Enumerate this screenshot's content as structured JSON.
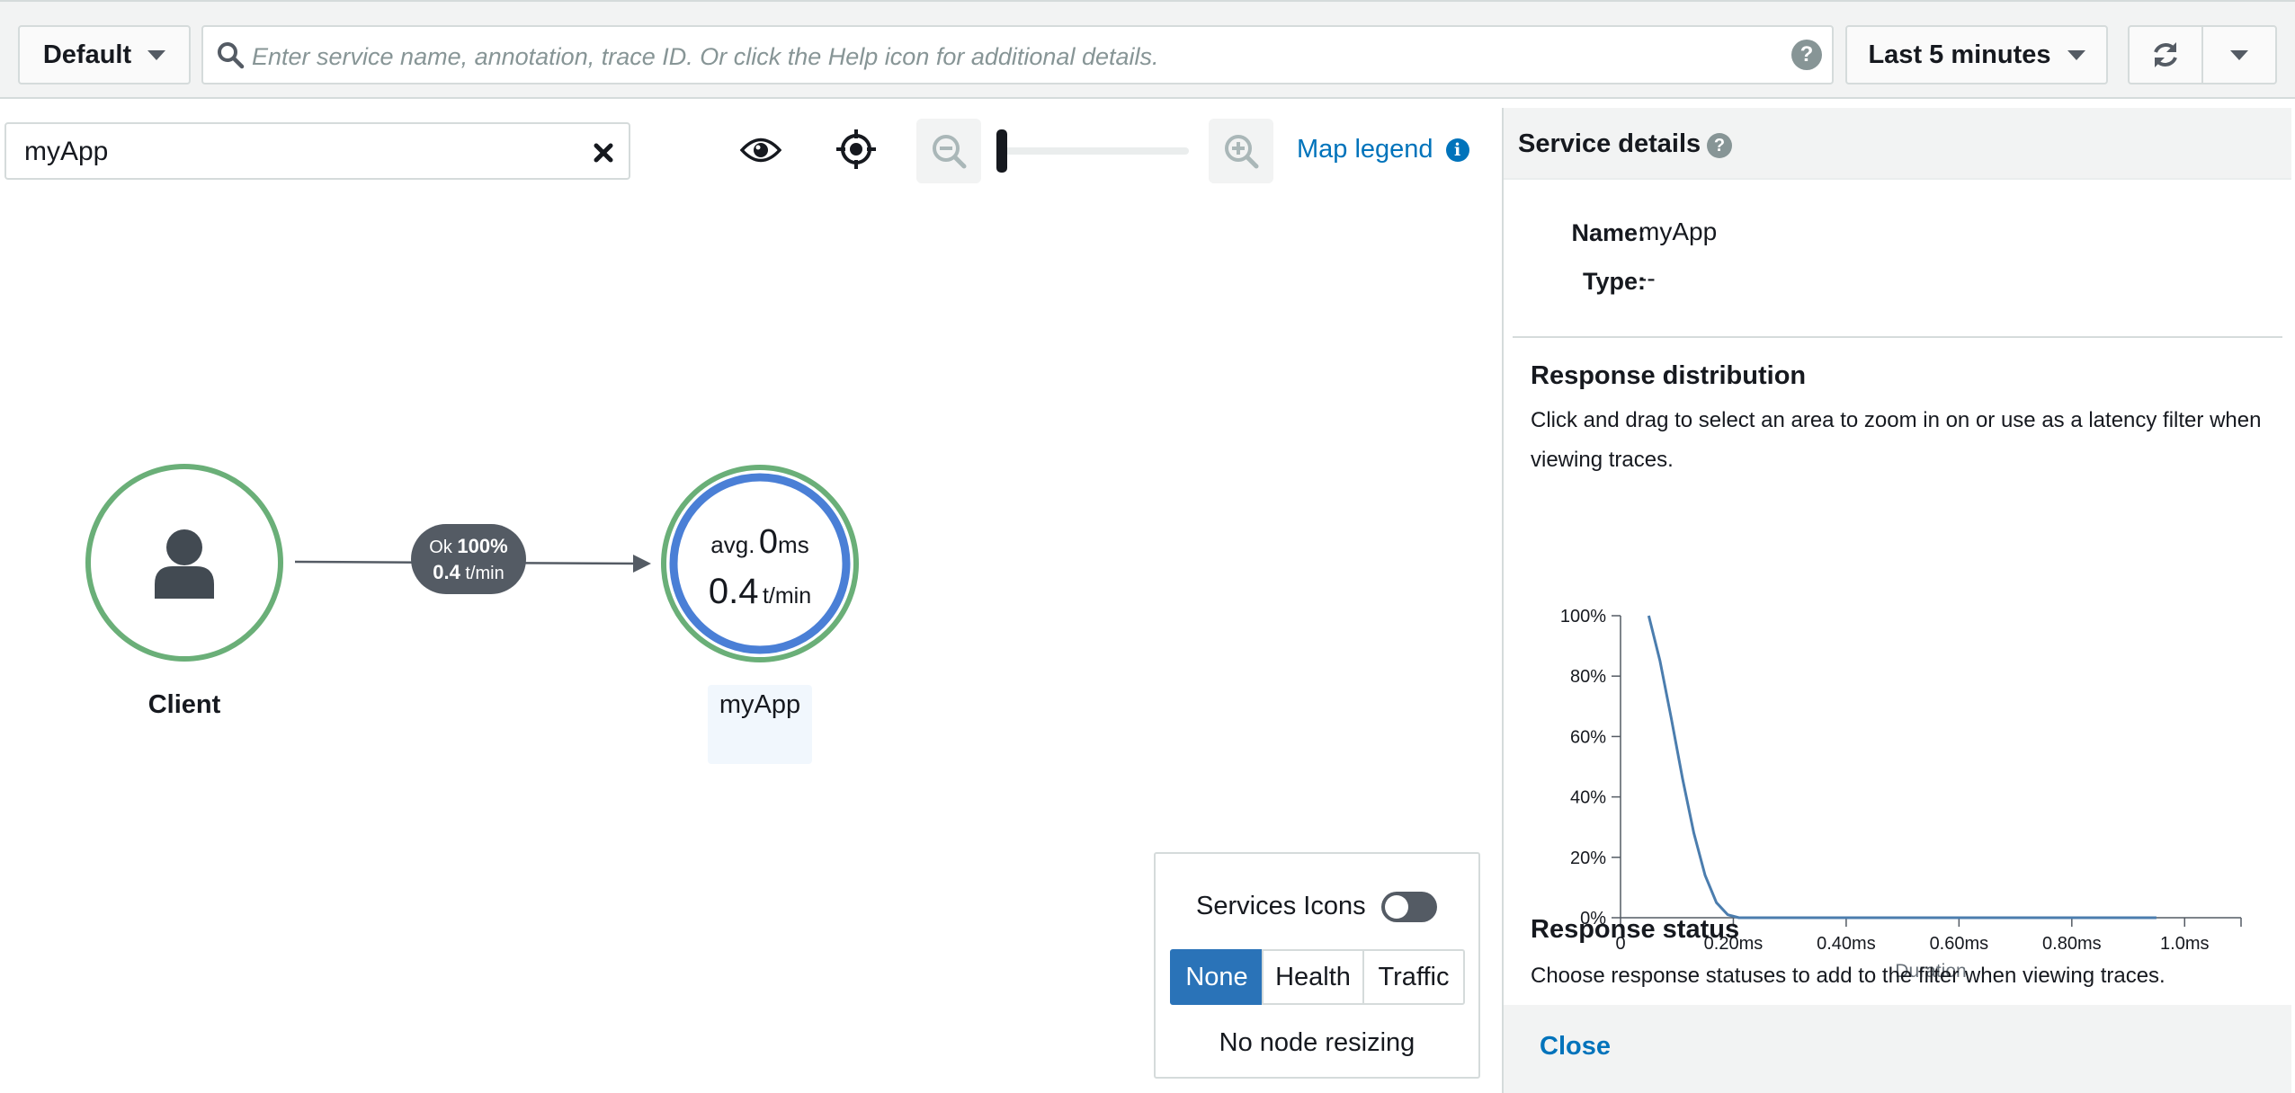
{
  "toolbar": {
    "group_label": "Default",
    "search_placeholder": "Enter service name, annotation, trace ID. Or click the Help icon for additional details.",
    "help_glyph": "?",
    "time_range_label": "Last 5 minutes"
  },
  "filter": {
    "value": "myApp"
  },
  "map_tools": {
    "map_legend_label": "Map legend",
    "info_glyph": "i",
    "zoom_level": 0
  },
  "map": {
    "client": {
      "label": "Client"
    },
    "edge": {
      "status": "Ok",
      "percent": "100%",
      "rate": "0.4",
      "rate_unit": "t/min"
    },
    "service": {
      "label": "myApp",
      "avg_prefix": "avg.",
      "avg_value": "0",
      "avg_unit": "ms",
      "rate": "0.4",
      "rate_unit": "t/min"
    }
  },
  "legend_panel": {
    "services_icons_label": "Services Icons",
    "services_icons_enabled": false,
    "segments": [
      "None",
      "Health",
      "Traffic"
    ],
    "selected_segment": "None",
    "resizing_text": "No node resizing"
  },
  "details": {
    "title": "Service details",
    "help_glyph": "?",
    "name_label": "Name:",
    "name_value": "myApp",
    "type_label": "Type:",
    "type_value": "--",
    "distribution_title": "Response distribution",
    "distribution_desc": "Click and drag to select an area to zoom in on or use as a latency filter when viewing traces.",
    "status_title": "Response status",
    "status_desc": "Choose response statuses to add to the filter when viewing traces.",
    "close_label": "Close"
  },
  "colors": {
    "ok_green": "#6aaf78",
    "service_blue": "#4a7fd6",
    "link_blue": "#0073bb",
    "selected_blue": "#2a73b8",
    "line_blue": "#4b7dae"
  },
  "chart_data": {
    "type": "line",
    "title": "",
    "xlabel": "Duration",
    "ylabel": "",
    "xlim": [
      0,
      1.1
    ],
    "ylim": [
      0,
      100
    ],
    "x_ticks": [
      0,
      0.2,
      0.4,
      0.6,
      0.8,
      1.0
    ],
    "x_tick_labels": [
      "0",
      "0.20ms",
      "0.40ms",
      "0.60ms",
      "0.80ms",
      "1.0ms"
    ],
    "y_ticks": [
      0,
      20,
      40,
      60,
      80,
      100
    ],
    "y_tick_labels": [
      "0%",
      "20%",
      "40%",
      "60%",
      "80%",
      "100%"
    ],
    "grid": false,
    "series": [
      {
        "x": [
          0.05,
          0.07,
          0.09,
          0.11,
          0.13,
          0.15,
          0.17,
          0.19,
          0.21,
          0.3,
          0.5,
          0.7,
          0.95
        ],
        "y": [
          100,
          85,
          66,
          46,
          28,
          14,
          5,
          1,
          0,
          0,
          0,
          0,
          0
        ]
      }
    ]
  }
}
